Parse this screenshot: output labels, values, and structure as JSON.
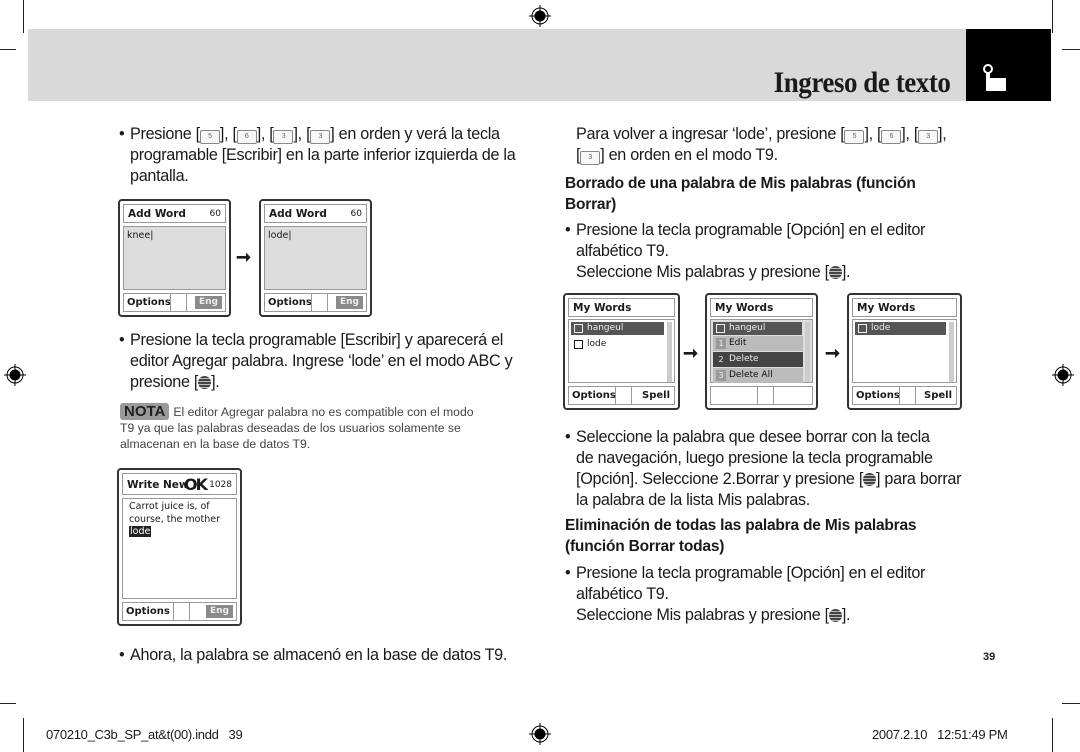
{
  "header": {
    "title": "Ingreso de texto",
    "section_icon": "hand-pointer-icon"
  },
  "left": {
    "bullet1": {
      "prefix": "Presione [",
      "keys": [
        "5",
        "6",
        "3",
        "3"
      ],
      "suffix": "] en orden y verá la tecla",
      "line2": "programable [Escribir] en la parte inferior izquierda de la",
      "line3": "pantalla."
    },
    "screens1": [
      {
        "title": "Add Word",
        "count": "60",
        "text": "knee",
        "soft_left": "Options",
        "mode": "Eng"
      },
      {
        "title": "Add Word",
        "count": "60",
        "text": "lode",
        "soft_left": "Options",
        "mode": "Eng"
      }
    ],
    "arrow": "➞",
    "bullet2": {
      "line1": "Presione la tecla programable [Escribir] y aparecerá el",
      "line2": "editor Agregar palabra. Ingrese ‘lode’ en el modo ABC y",
      "line3_prefix": "presione [",
      "line3_suffix": "]."
    },
    "note": {
      "badge": "NOTA",
      "line1": "El editor Agregar palabra no es compatible con el modo",
      "line2": "T9 ya que las palabras deseadas de los usuarios solamente se",
      "line3": "almacenan en la base de datos T9."
    },
    "screen_write": {
      "title": "Write New",
      "ok": "OK",
      "count": "1028",
      "line1": "Carrot juice is, of",
      "line2": "course, the mother",
      "highlight": "lode",
      "soft_left": "Options",
      "mode": "Eng"
    },
    "bullet3": "Ahora, la palabra se almacenó en la base de datos T9."
  },
  "right": {
    "para1": {
      "line1_prefix": "Para volver a ingresar ‘lode’, presione [",
      "keys": [
        "5",
        "6",
        "3",
        "3"
      ],
      "line2_suffix": "] en orden en el modo T9."
    },
    "heading1": "Borrado de una palabra de Mis palabras (función Borrar)",
    "bullet1": {
      "line1": "Presione la tecla programable [Opción] en el editor",
      "line2": "alfabético T9.",
      "line3_prefix": "Seleccione Mis palabras y presione [",
      "line3_suffix": "]."
    },
    "screens": [
      {
        "title": "My Words",
        "items": [
          "hangeul",
          "lode"
        ],
        "selected": 0,
        "soft_left": "Options",
        "soft_right": "Spell"
      },
      {
        "title": "My Words",
        "items": [
          "hangeul"
        ],
        "menu": [
          "Edit",
          "Delete",
          "Delete All"
        ],
        "menu_selected": 1
      },
      {
        "title": "My Words",
        "items": [
          "lode"
        ],
        "selected": 0,
        "soft_left": "Options",
        "soft_right": "Spell"
      }
    ],
    "bullet2": {
      "line1": "Seleccione la palabra que desee borrar con la tecla",
      "line2": "de navegación, luego presione la tecla programable",
      "line3_prefix": "[Opción]. Seleccione 2.Borrar y presione [",
      "line3_suffix": "] para borrar",
      "line4": "la palabra de la lista Mis palabras."
    },
    "heading2_line1": "Eliminación de todas las palabra de Mis palabras",
    "heading2_line2": "(función Borrar todas)",
    "bullet3": {
      "line1": "Presione la tecla programable [Opción] en el editor",
      "line2": "alfabético T9.",
      "line3_prefix": "Seleccione Mis palabras y presione [",
      "line3_suffix": "]."
    }
  },
  "page_number": "39",
  "footer": {
    "filename": "070210_C3b_SP_at&t(00).indd   39",
    "timestamp": "2007.2.10   12:51:49 PM"
  }
}
